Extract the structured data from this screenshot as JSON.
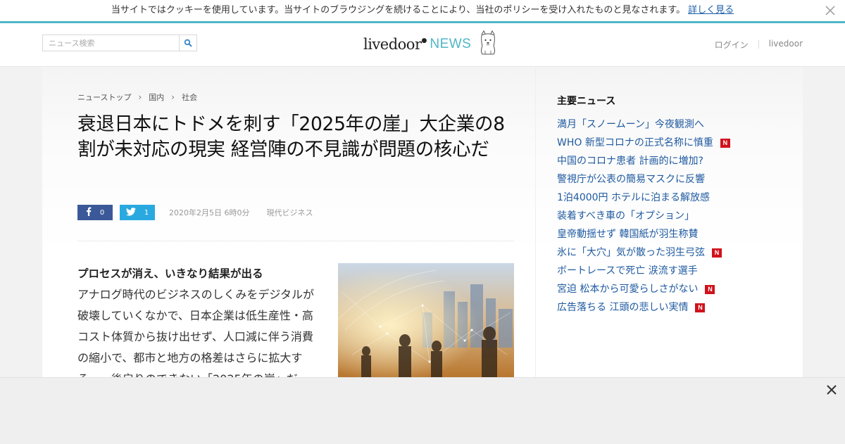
{
  "cookie_bar": {
    "message": "当サイトではクッキーを使用しています。当サイトのブラウジングを続けることにより、当社のポリシーを受け入れたものと見なされます。",
    "link": "詳しく見る"
  },
  "header": {
    "search_placeholder": "ニュース検索",
    "logo_main": "livedoor",
    "logo_news": "NEWS",
    "login": "ログイン",
    "livedoor_link": "livedoor"
  },
  "breadcrumb": [
    "ニューストップ",
    "国内",
    "社会"
  ],
  "article": {
    "title": "衰退日本にトドメを刺す「2025年の崖」大企業の8割が未対応の現実 経営陣の不見識が問題の核心だ",
    "share_facebook_count": "0",
    "share_twitter_count": "1",
    "date": "2020年2月5日 6時0分",
    "source": "現代ビジネス",
    "subheading": "プロセスが消え、いきなり結果が出る",
    "body": "アナログ時代のビジネスのしくみをデジタルが破壊していくなかで、日本企業は低生産性・高コスト体質から抜け出せず、人口減に伴う消費の縮小で、都市と地方の格差はさらに拡大する……後戻りのできない「2025年の崖」だ"
  },
  "sidebar": {
    "heading": "主要ニュース",
    "items": [
      {
        "text": "満月「スノームーン」今夜観測へ",
        "new": false
      },
      {
        "text": "WHO 新型コロナの正式名称に慎重",
        "new": true
      },
      {
        "text": "中国のコロナ患者 計画的に増加?",
        "new": false
      },
      {
        "text": "警視庁が公表の簡易マスクに反響",
        "new": false
      },
      {
        "text": "1泊4000円 ホテルに泊まる解放感",
        "new": false
      },
      {
        "text": "装着すべき車の「オプション」",
        "new": false
      },
      {
        "text": "皇帝動揺せず 韓国紙が羽生称賛",
        "new": false
      },
      {
        "text": "氷に「大穴」気が散った羽生弓弦",
        "new": true
      },
      {
        "text": "ボートレースで死亡 涙流す選手",
        "new": false
      },
      {
        "text": "宮迫 松本から可愛らしさがない",
        "new": true
      },
      {
        "text": "広告落ちる 江頭の悲しい実情",
        "new": true
      }
    ],
    "new_badge": "N"
  },
  "colors": {
    "accent": "#4fb6c8",
    "link": "#1f5aa0",
    "facebook": "#3b5998",
    "twitter": "#2aa9e0",
    "new_badge": "#d0121b"
  }
}
